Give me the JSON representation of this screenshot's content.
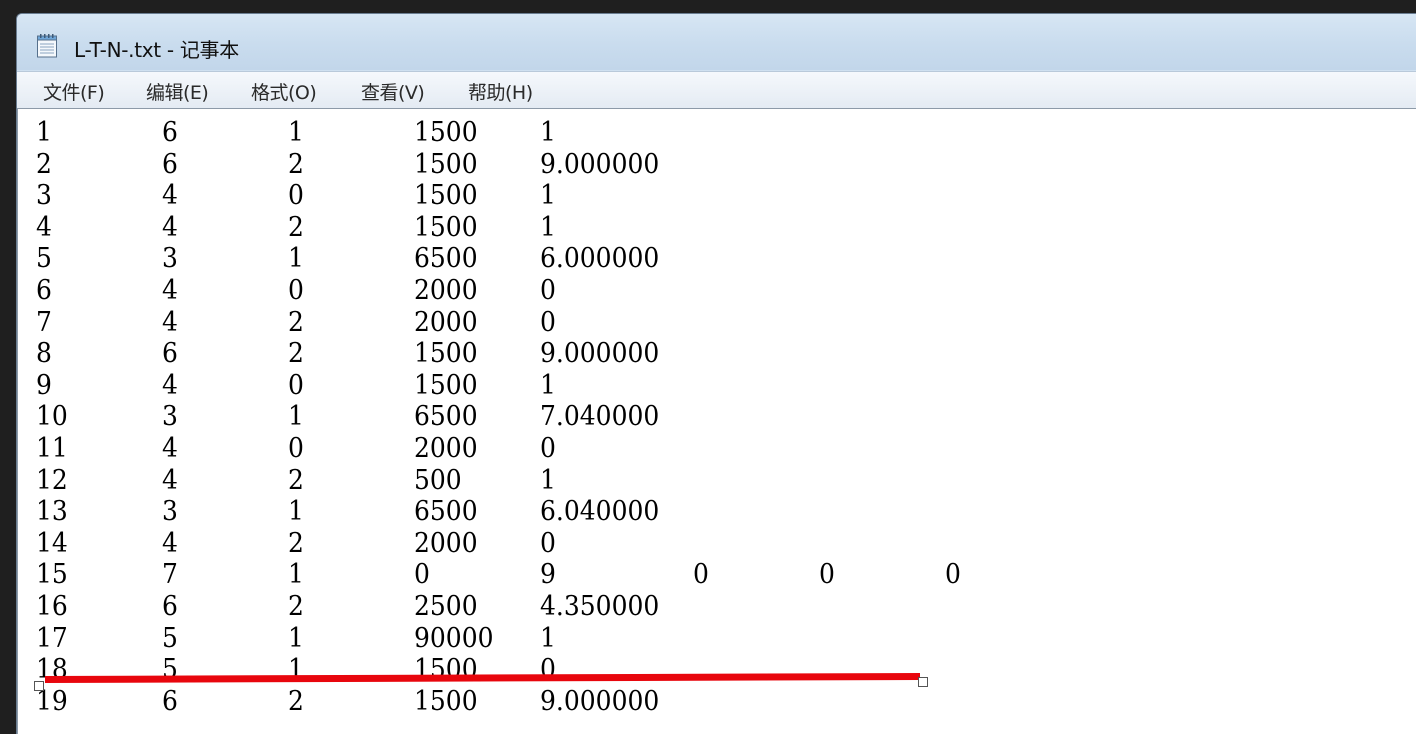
{
  "window": {
    "title": "L-T-N-.txt - 记事本",
    "app_icon": "notepad-icon"
  },
  "menu": [
    {
      "label": "文件(F)"
    },
    {
      "label": "编辑(E)"
    },
    {
      "label": "格式(O)"
    },
    {
      "label": "查看(V)"
    },
    {
      "label": "帮助(H)"
    }
  ],
  "document": {
    "rows": [
      [
        "1",
        "6",
        "1",
        "1500",
        "1"
      ],
      [
        "2",
        "6",
        "2",
        "1500",
        "9.000000"
      ],
      [
        "3",
        "4",
        "0",
        "1500",
        "1"
      ],
      [
        "4",
        "4",
        "2",
        "1500",
        "1"
      ],
      [
        "5",
        "3",
        "1",
        "6500",
        "6.000000"
      ],
      [
        "6",
        "4",
        "0",
        "2000",
        "0"
      ],
      [
        "7",
        "4",
        "2",
        "2000",
        "0"
      ],
      [
        "8",
        "6",
        "2",
        "1500",
        "9.000000"
      ],
      [
        "9",
        "4",
        "0",
        "1500",
        "1"
      ],
      [
        "10",
        "3",
        "1",
        "6500",
        "7.040000"
      ],
      [
        "11",
        "4",
        "0",
        "2000",
        "0"
      ],
      [
        "12",
        "4",
        "2",
        "500",
        "1"
      ],
      [
        "13",
        "3",
        "1",
        "6500",
        "6.040000"
      ],
      [
        "14",
        "4",
        "2",
        "2000",
        "0"
      ],
      [
        "15",
        "7",
        "1",
        "0",
        "9",
        "0",
        "0",
        "0"
      ],
      [
        "16",
        "6",
        "2",
        "2500",
        "4.350000"
      ],
      [
        "17",
        "5",
        "1",
        "90000",
        "1"
      ],
      [
        "18",
        "5",
        "1",
        "1500",
        "0"
      ],
      [
        "19",
        "6",
        "2",
        "1500",
        "9.000000"
      ]
    ]
  },
  "annotation": {
    "shape": "red-line",
    "color": "#e8060d"
  }
}
